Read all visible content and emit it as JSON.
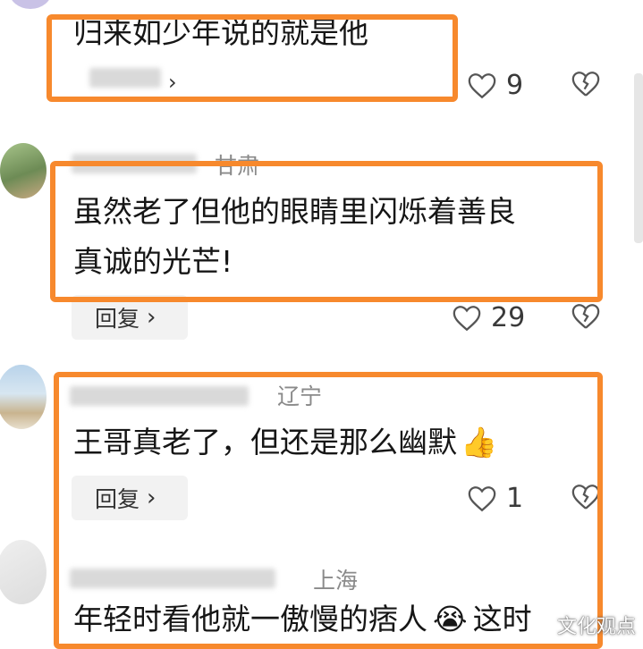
{
  "comments": [
    {
      "text_lines": [
        "归来如少年说的就是他"
      ],
      "reply_label": "",
      "likes": "9",
      "location": ""
    },
    {
      "text_lines": [
        "虽然老了但他的眼睛里闪烁着善良",
        "真诚的光芒!"
      ],
      "reply_label": "回复",
      "likes": "29",
      "location": "甘肃"
    },
    {
      "text_lines": [
        "王哥真老了，但还是那么幽默"
      ],
      "reply_label": "回复",
      "likes": "1",
      "location": "辽宁",
      "emoji": "👍"
    },
    {
      "text_lines": [
        "年轻时看他就一傲慢的痞人",
        "这时"
      ],
      "reply_label": "",
      "likes": "",
      "location": "上海",
      "emoji": "😭"
    }
  ],
  "reply_chevron": "›",
  "icons": [
    "heart-outline-icon",
    "broken-heart-icon",
    "chevron-right-icon"
  ],
  "highlight_color": "#f7892d",
  "watermark": "文化观点"
}
